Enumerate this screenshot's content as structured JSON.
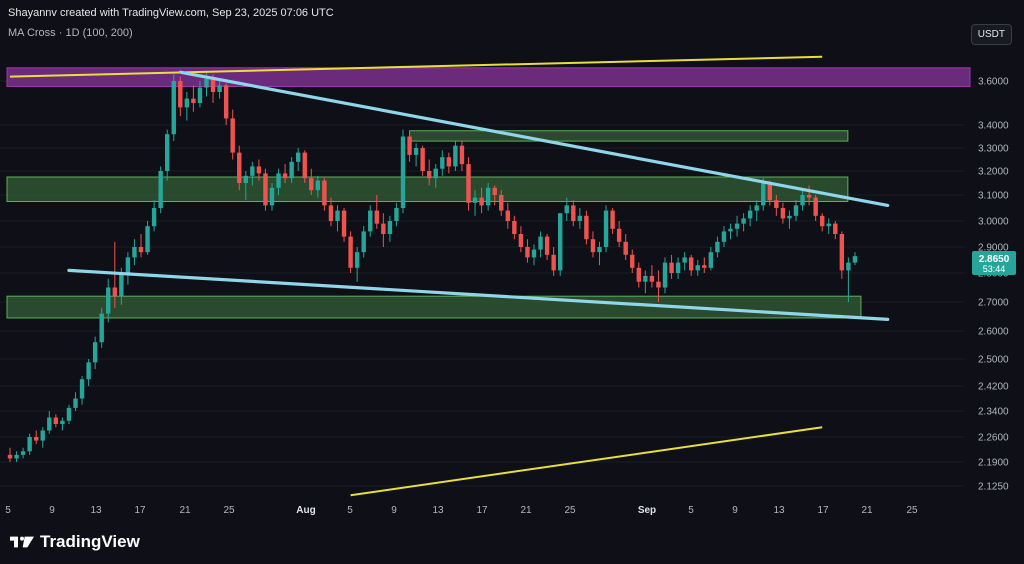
{
  "header": {
    "attribution": "Shayannv created with TradingView.com, Sep 23, 2025 07:06 UTC",
    "indicator": "MA Cross · 1D (100, 200)",
    "currency": "USDT"
  },
  "brand": {
    "name": "TradingView",
    "logo_icon": "tradingview-logo-icon"
  },
  "colors": {
    "background": "#0f1017",
    "up": "#26a69a",
    "down": "#ef5350",
    "trendline": "#8fd6ea",
    "channel": "#e9df3c",
    "supply_zone": "#7d2f8e",
    "demand_zone": "#3f7a3f",
    "price_tag": "#26a69a"
  },
  "chart_data": {
    "type": "candlestick",
    "y_ticks": [
      "3.6000",
      "3.4000",
      "3.3000",
      "3.2000",
      "3.1000",
      "3.0000",
      "2.9000",
      "2.8000",
      "2.7000",
      "2.6000",
      "2.5000",
      "2.4200",
      "2.3400",
      "2.2600",
      "2.1900",
      "2.1250"
    ],
    "x_ticks": [
      {
        "label": "5",
        "bold": false
      },
      {
        "label": "9",
        "bold": false
      },
      {
        "label": "13",
        "bold": false
      },
      {
        "label": "17",
        "bold": false
      },
      {
        "label": "21",
        "bold": false
      },
      {
        "label": "25",
        "bold": false
      },
      {
        "label": "Aug",
        "bold": true
      },
      {
        "label": "5",
        "bold": false
      },
      {
        "label": "9",
        "bold": false
      },
      {
        "label": "13",
        "bold": false
      },
      {
        "label": "17",
        "bold": false
      },
      {
        "label": "21",
        "bold": false
      },
      {
        "label": "25",
        "bold": false
      },
      {
        "label": "Sep",
        "bold": true
      },
      {
        "label": "5",
        "bold": false
      },
      {
        "label": "9",
        "bold": false
      },
      {
        "label": "13",
        "bold": false
      },
      {
        "label": "17",
        "bold": false
      },
      {
        "label": "21",
        "bold": false
      },
      {
        "label": "25",
        "bold": false
      }
    ],
    "last_price": "2.8650",
    "countdown": "53:44",
    "candles": [
      [
        2.21,
        2.23,
        2.19,
        2.2
      ],
      [
        2.2,
        2.22,
        2.19,
        2.21
      ],
      [
        2.21,
        2.23,
        2.2,
        2.22
      ],
      [
        2.22,
        2.27,
        2.21,
        2.26
      ],
      [
        2.26,
        2.28,
        2.24,
        2.25
      ],
      [
        2.25,
        2.29,
        2.23,
        2.28
      ],
      [
        2.28,
        2.34,
        2.27,
        2.32
      ],
      [
        2.32,
        2.33,
        2.29,
        2.3
      ],
      [
        2.3,
        2.32,
        2.28,
        2.31
      ],
      [
        2.31,
        2.36,
        2.3,
        2.35
      ],
      [
        2.35,
        2.4,
        2.34,
        2.38
      ],
      [
        2.38,
        2.45,
        2.36,
        2.44
      ],
      [
        2.44,
        2.5,
        2.42,
        2.49
      ],
      [
        2.49,
        2.58,
        2.47,
        2.56
      ],
      [
        2.56,
        2.68,
        2.54,
        2.66
      ],
      [
        2.66,
        2.78,
        2.63,
        2.75
      ],
      [
        2.75,
        2.92,
        2.68,
        2.72
      ],
      [
        2.72,
        2.82,
        2.69,
        2.8
      ],
      [
        2.8,
        2.88,
        2.76,
        2.86
      ],
      [
        2.86,
        2.93,
        2.83,
        2.9
      ],
      [
        2.9,
        2.95,
        2.86,
        2.88
      ],
      [
        2.88,
        3.0,
        2.87,
        2.98
      ],
      [
        2.98,
        3.08,
        2.96,
        3.05
      ],
      [
        3.05,
        3.22,
        3.03,
        3.2
      ],
      [
        3.2,
        3.38,
        3.16,
        3.36
      ],
      [
        3.36,
        3.63,
        3.33,
        3.6
      ],
      [
        3.6,
        3.62,
        3.44,
        3.48
      ],
      [
        3.48,
        3.55,
        3.42,
        3.52
      ],
      [
        3.52,
        3.58,
        3.46,
        3.5
      ],
      [
        3.5,
        3.6,
        3.48,
        3.57
      ],
      [
        3.57,
        3.64,
        3.53,
        3.61
      ],
      [
        3.61,
        3.63,
        3.5,
        3.55
      ],
      [
        3.55,
        3.6,
        3.52,
        3.58
      ],
      [
        3.58,
        3.59,
        3.4,
        3.43
      ],
      [
        3.43,
        3.47,
        3.25,
        3.28
      ],
      [
        3.28,
        3.31,
        3.12,
        3.15
      ],
      [
        3.15,
        3.2,
        3.08,
        3.18
      ],
      [
        3.18,
        3.24,
        3.14,
        3.22
      ],
      [
        3.22,
        3.25,
        3.16,
        3.19
      ],
      [
        3.19,
        3.21,
        3.04,
        3.06
      ],
      [
        3.06,
        3.15,
        3.04,
        3.13
      ],
      [
        3.13,
        3.21,
        3.1,
        3.19
      ],
      [
        3.19,
        3.23,
        3.15,
        3.17
      ],
      [
        3.17,
        3.26,
        3.15,
        3.24
      ],
      [
        3.24,
        3.3,
        3.2,
        3.28
      ],
      [
        3.28,
        3.29,
        3.15,
        3.17
      ],
      [
        3.17,
        3.21,
        3.1,
        3.12
      ],
      [
        3.12,
        3.18,
        3.09,
        3.16
      ],
      [
        3.16,
        3.17,
        3.04,
        3.06
      ],
      [
        3.06,
        3.09,
        2.98,
        3.0
      ],
      [
        3.0,
        3.06,
        2.96,
        3.04
      ],
      [
        3.04,
        3.05,
        2.92,
        2.94
      ],
      [
        2.94,
        2.96,
        2.8,
        2.82
      ],
      [
        2.82,
        2.9,
        2.77,
        2.88
      ],
      [
        2.88,
        2.98,
        2.86,
        2.96
      ],
      [
        2.96,
        3.06,
        2.94,
        3.04
      ],
      [
        3.04,
        3.1,
        2.97,
        2.99
      ],
      [
        2.99,
        3.03,
        2.9,
        2.95
      ],
      [
        2.95,
        3.02,
        2.92,
        3.0
      ],
      [
        3.0,
        3.07,
        2.98,
        3.05
      ],
      [
        3.05,
        3.38,
        3.03,
        3.35
      ],
      [
        3.35,
        3.37,
        3.24,
        3.27
      ],
      [
        3.27,
        3.32,
        3.22,
        3.3
      ],
      [
        3.3,
        3.31,
        3.18,
        3.2
      ],
      [
        3.2,
        3.25,
        3.14,
        3.17
      ],
      [
        3.17,
        3.23,
        3.13,
        3.21
      ],
      [
        3.21,
        3.29,
        3.18,
        3.26
      ],
      [
        3.26,
        3.28,
        3.19,
        3.22
      ],
      [
        3.22,
        3.33,
        3.2,
        3.31
      ],
      [
        3.31,
        3.33,
        3.2,
        3.23
      ],
      [
        3.23,
        3.26,
        3.04,
        3.07
      ],
      [
        3.07,
        3.12,
        3.02,
        3.09
      ],
      [
        3.09,
        3.13,
        3.03,
        3.06
      ],
      [
        3.06,
        3.15,
        3.04,
        3.13
      ],
      [
        3.13,
        3.14,
        3.06,
        3.1
      ],
      [
        3.1,
        3.12,
        3.02,
        3.04
      ],
      [
        3.04,
        3.07,
        2.97,
        3.0
      ],
      [
        3.0,
        3.02,
        2.93,
        2.95
      ],
      [
        2.95,
        2.98,
        2.88,
        2.9
      ],
      [
        2.9,
        2.93,
        2.84,
        2.86
      ],
      [
        2.86,
        2.91,
        2.83,
        2.89
      ],
      [
        2.89,
        2.96,
        2.86,
        2.94
      ],
      [
        2.94,
        2.95,
        2.85,
        2.87
      ],
      [
        2.87,
        2.9,
        2.79,
        2.81
      ],
      [
        2.81,
        2.96,
        2.79,
        3.03
      ],
      [
        3.03,
        3.09,
        3.0,
        3.06
      ],
      [
        3.06,
        3.08,
        2.98,
        3.0
      ],
      [
        3.0,
        3.05,
        2.97,
        3.02
      ],
      [
        3.02,
        3.04,
        2.91,
        2.93
      ],
      [
        2.93,
        2.96,
        2.86,
        2.88
      ],
      [
        2.88,
        2.92,
        2.83,
        2.9
      ],
      [
        2.9,
        3.06,
        2.88,
        3.04
      ],
      [
        3.04,
        3.05,
        2.95,
        2.97
      ],
      [
        2.97,
        3.0,
        2.9,
        2.92
      ],
      [
        2.92,
        2.95,
        2.85,
        2.87
      ],
      [
        2.87,
        2.89,
        2.8,
        2.82
      ],
      [
        2.82,
        2.84,
        2.75,
        2.77
      ],
      [
        2.77,
        2.81,
        2.73,
        2.79
      ],
      [
        2.79,
        2.83,
        2.75,
        2.77
      ],
      [
        2.77,
        2.81,
        2.7,
        2.75
      ],
      [
        2.75,
        2.86,
        2.73,
        2.84
      ],
      [
        2.84,
        2.87,
        2.78,
        2.8
      ],
      [
        2.8,
        2.86,
        2.78,
        2.84
      ],
      [
        2.84,
        2.88,
        2.81,
        2.86
      ],
      [
        2.86,
        2.87,
        2.79,
        2.81
      ],
      [
        2.81,
        2.85,
        2.79,
        2.83
      ],
      [
        2.83,
        2.86,
        2.8,
        2.82
      ],
      [
        2.82,
        2.9,
        2.81,
        2.88
      ],
      [
        2.88,
        2.94,
        2.86,
        2.92
      ],
      [
        2.92,
        2.98,
        2.9,
        2.96
      ],
      [
        2.96,
        2.99,
        2.93,
        2.97
      ],
      [
        2.97,
        3.02,
        2.94,
        2.99
      ],
      [
        2.99,
        3.03,
        2.96,
        3.01
      ],
      [
        3.01,
        3.06,
        2.98,
        3.04
      ],
      [
        3.04,
        3.08,
        3.0,
        3.06
      ],
      [
        3.06,
        3.17,
        3.04,
        3.15
      ],
      [
        3.15,
        3.16,
        3.06,
        3.08
      ],
      [
        3.08,
        3.1,
        3.02,
        3.05
      ],
      [
        3.05,
        3.07,
        2.99,
        3.01
      ],
      [
        3.01,
        3.04,
        2.97,
        3.02
      ],
      [
        3.02,
        3.08,
        3.0,
        3.06
      ],
      [
        3.06,
        3.12,
        3.04,
        3.1
      ],
      [
        3.1,
        3.14,
        3.06,
        3.09
      ],
      [
        3.09,
        3.1,
        3.0,
        3.02
      ],
      [
        3.02,
        3.03,
        2.96,
        2.98
      ],
      [
        2.98,
        3.01,
        2.95,
        2.99
      ],
      [
        2.99,
        3.0,
        2.93,
        2.95
      ],
      [
        2.95,
        2.96,
        2.78,
        2.81
      ],
      [
        2.81,
        2.86,
        2.7,
        2.84
      ],
      [
        2.84,
        2.88,
        2.83,
        2.865
      ]
    ],
    "zones": [
      {
        "kind": "supply",
        "top": 3.66,
        "bottom": 3.575,
        "from_index": 0,
        "to_index": 135
      },
      {
        "kind": "demand",
        "top": 3.375,
        "bottom": 3.33,
        "from_index": 61,
        "to_index": 127
      },
      {
        "kind": "demand",
        "top": 3.175,
        "bottom": 3.075,
        "from_index": 0,
        "to_index": 127
      },
      {
        "kind": "demand",
        "top": 2.72,
        "bottom": 2.645,
        "from_index": 0,
        "to_index": 129
      }
    ],
    "trendlines": [
      {
        "kind": "resistance",
        "from": [
          26,
          3.64
        ],
        "to": [
          134,
          3.06
        ]
      },
      {
        "kind": "support",
        "from": [
          9,
          2.81
        ],
        "to": [
          134,
          2.64
        ]
      }
    ],
    "channel_lines": [
      {
        "from": [
          0,
          3.62
        ],
        "to": [
          124,
          3.71
        ]
      },
      {
        "from": [
          52,
          2.1
        ],
        "to": [
          124,
          2.29
        ]
      }
    ]
  }
}
